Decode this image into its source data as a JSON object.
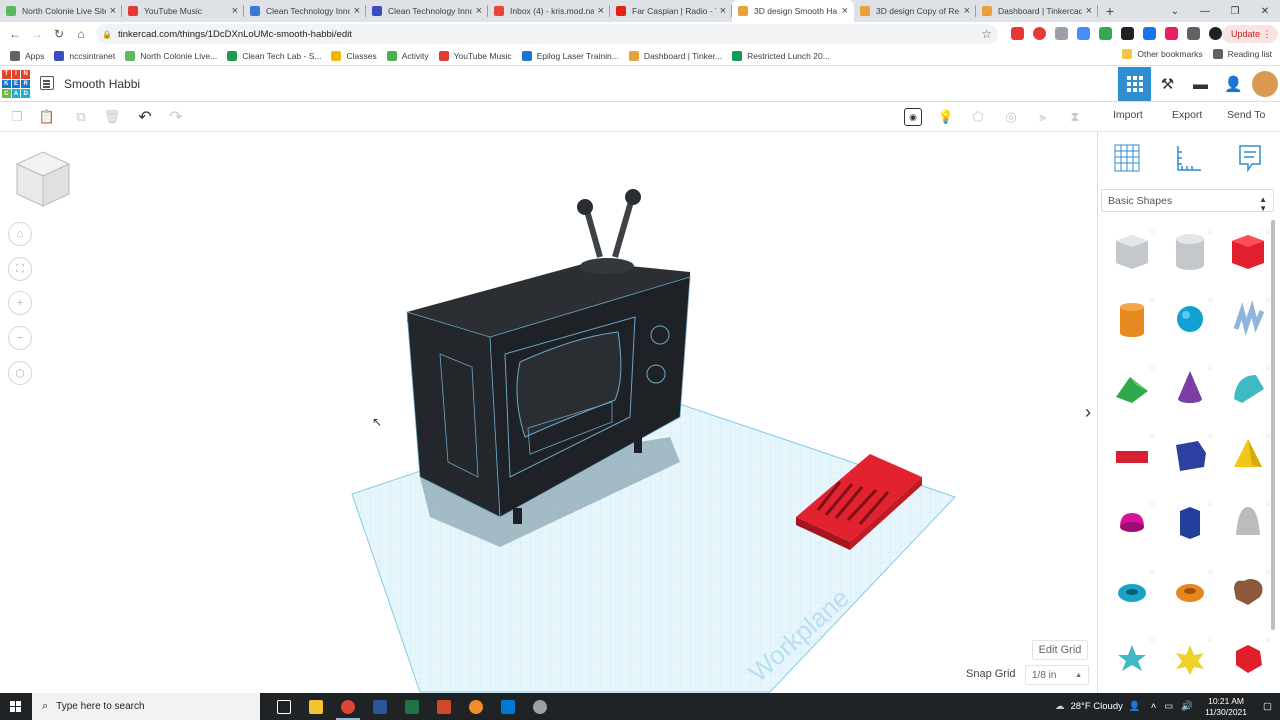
{
  "browser": {
    "tabs": [
      {
        "title": "North Colonie Live Site",
        "color": "#5cb85c"
      },
      {
        "title": "YouTube Music",
        "color": "#e53935"
      },
      {
        "title": "Clean Technology Inno...",
        "color": "#3b78d8"
      },
      {
        "title": "Clean Technology Inno...",
        "color": "#3b4bbf"
      },
      {
        "title": "Inbox (4) - kris.mod.na...",
        "color": "#ea4335"
      },
      {
        "title": "Far Caspian | Radio - Y...",
        "color": "#e62117"
      },
      {
        "title": "3D design Smooth Ha...",
        "color": "#e9a23b"
      },
      {
        "title": "3D design Copy of Re...",
        "color": "#e9a23b"
      },
      {
        "title": "Dashboard | Tinkercad",
        "color": "#e9a23b"
      }
    ],
    "active_tab": 6,
    "url": "tinkercad.com/things/1DcDXnLoUMc-smooth-habbi/edit",
    "update_label": "Update",
    "bookmarks": [
      {
        "label": "Apps",
        "color": "#5f6368"
      },
      {
        "label": "nccsintranet",
        "color": "#3b4bbf"
      },
      {
        "label": "North Colonie Live...",
        "color": "#5cb85c"
      },
      {
        "label": "Clean Tech Lab - S...",
        "color": "#1a9d48"
      },
      {
        "label": "Classes",
        "color": "#f4b400"
      },
      {
        "label": "Activity",
        "color": "#4caf50"
      },
      {
        "label": "YouTube Music",
        "color": "#e53935"
      },
      {
        "label": "Epilog Laser Trainin...",
        "color": "#1976d2"
      },
      {
        "label": "Dashboard | Tinker...",
        "color": "#e9a23b"
      },
      {
        "label": "Restricted Lunch 20...",
        "color": "#0f9d58"
      }
    ],
    "other_bookmarks": "Other bookmarks",
    "reading_list": "Reading list"
  },
  "app": {
    "logo_letters": [
      "T",
      "I",
      "N",
      "K",
      "E",
      "R",
      "C",
      "A",
      "D"
    ],
    "logo_colors": [
      "#e8412a",
      "#e8412a",
      "#e8412a",
      "#1477d1",
      "#1477d1",
      "#1477d1",
      "#75b73c",
      "#1bb0d0",
      "#1bb0d0"
    ],
    "design_name": "Smooth Habbi",
    "actions": {
      "import": "Import",
      "export": "Export",
      "send_to": "Send To"
    },
    "shape_category": "Basic Shapes",
    "edit_grid": "Edit Grid",
    "snap_grid_label": "Snap Grid",
    "snap_grid_value": "1/8 in",
    "workplane_watermark": "Workplane",
    "accent": "#2f8ecf",
    "shapes": [
      {
        "name": "box-hole",
        "color": "#c4c8cc"
      },
      {
        "name": "cylinder-hole",
        "color": "#c4c8cc"
      },
      {
        "name": "box",
        "color": "#e0202f"
      },
      {
        "name": "cylinder",
        "color": "#e8891f"
      },
      {
        "name": "sphere",
        "color": "#129fd1"
      },
      {
        "name": "scribble",
        "color": "#8fb5dc"
      },
      {
        "name": "roof",
        "color": "#30a94b"
      },
      {
        "name": "cone",
        "color": "#7b3fa4"
      },
      {
        "name": "round-roof",
        "color": "#3fb9c3"
      },
      {
        "name": "text",
        "color": "#d62133"
      },
      {
        "name": "wedge",
        "color": "#2d3f9f"
      },
      {
        "name": "pyramid",
        "color": "#f2c617"
      },
      {
        "name": "half-sphere",
        "color": "#d8119b"
      },
      {
        "name": "polygon",
        "color": "#233f9c"
      },
      {
        "name": "paraboloid",
        "color": "#bcbcbc"
      },
      {
        "name": "torus",
        "color": "#1aa3c8"
      },
      {
        "name": "tube",
        "color": "#e7871f"
      },
      {
        "name": "heart",
        "color": "#8a5a3a"
      },
      {
        "name": "star",
        "color": "#3fb9c3"
      },
      {
        "name": "star-6",
        "color": "#f0d12a"
      },
      {
        "name": "icosahedron",
        "color": "#e01f2a"
      }
    ]
  },
  "taskbar": {
    "search_placeholder": "Type here to search",
    "weather": "28°F  Cloudy",
    "time": "10:21 AM",
    "date": "11/30/2021",
    "apps": [
      {
        "name": "task-view",
        "color": "#ffffff"
      },
      {
        "name": "file-explorer",
        "color": "#f1c232"
      },
      {
        "name": "chrome",
        "color": "#db4437"
      },
      {
        "name": "word",
        "color": "#2b579a"
      },
      {
        "name": "excel",
        "color": "#217346"
      },
      {
        "name": "powerpoint",
        "color": "#d24726"
      },
      {
        "name": "sketch-app",
        "color": "#f28c28"
      },
      {
        "name": "outlook",
        "color": "#0078d4"
      },
      {
        "name": "settings-app",
        "color": "#9aa0a6"
      }
    ]
  }
}
